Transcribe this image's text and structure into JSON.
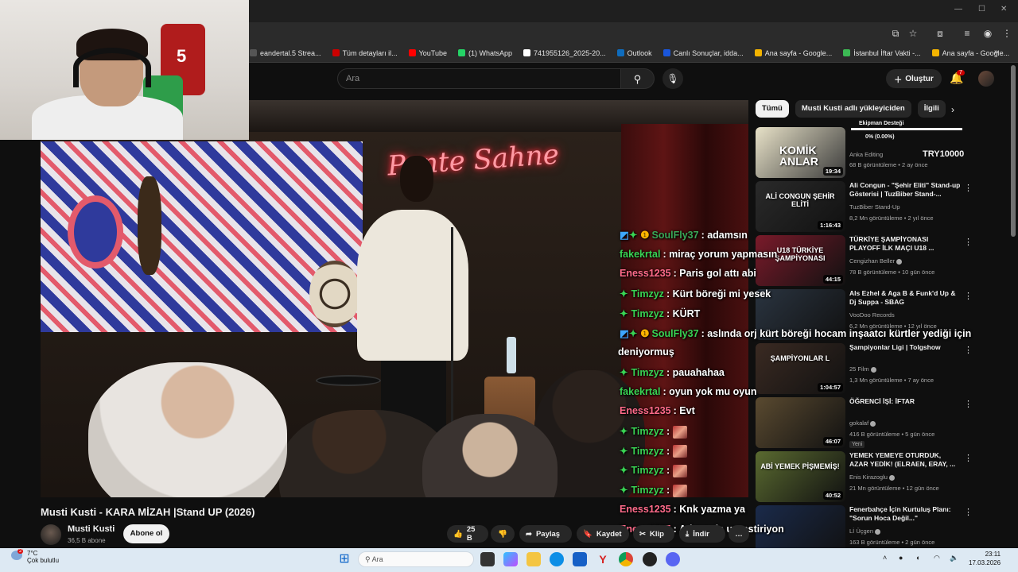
{
  "browser": {
    "bookmarks": [
      {
        "label": "eandertal.5 Strea...",
        "color": "#555555"
      },
      {
        "label": "Tüm detayları il...",
        "color": "#cc0000"
      },
      {
        "label": "YouTube",
        "color": "#ff0000"
      },
      {
        "label": "(1) WhatsApp",
        "color": "#25d366"
      },
      {
        "label": "741955126_2025-20...",
        "color": "#ffffff"
      },
      {
        "label": "Outlook",
        "color": "#0f6cbd"
      },
      {
        "label": "Canlı Sonuçlar, idda...",
        "color": "#1a56db"
      },
      {
        "label": "Ana sayfa - Google...",
        "color": "#f4b400"
      },
      {
        "label": "İstanbul İftar Vakti -...",
        "color": "#3cba54"
      },
      {
        "label": "Ana sayfa - Google...",
        "color": "#f4b400"
      }
    ]
  },
  "header": {
    "search_placeholder": "Ara",
    "create_label": "Oluştur",
    "notif_count": "7"
  },
  "video": {
    "title": "Musti Kusti - KARA MİZAH  |Stand UP (2026)",
    "neon_sign": "Ponte Sahne",
    "jersey_number": "5",
    "channel": "Musti Kusti",
    "subscribers": "36,5 B abone",
    "subscribe_label": "Abone ol",
    "likes": "25 B",
    "share_label": "Paylaş",
    "save_label": "Kaydet",
    "clip_label": "Klip",
    "download_label": "İndir"
  },
  "chat": [
    {
      "user": "SoulFly37",
      "color": "#3aa757",
      "text": "adamsın",
      "badges": true
    },
    {
      "user": "fakekrtal",
      "color": "#39d353",
      "text": "miraç yorum yapmasın"
    },
    {
      "user": "Eness1235",
      "color": "#ff6b8a",
      "text": "Paris gol attı abi"
    },
    {
      "user": "Timzyz",
      "color": "#39d353",
      "text": "Kürt böreği mi yesek",
      "diamond": true
    },
    {
      "user": "Timzyz",
      "color": "#39d353",
      "text": "KÜRT",
      "diamond": true
    },
    {
      "user": "SoulFly37",
      "color": "#39d353",
      "text": "aslında orj kürt böreği hocam inşaatcı kürtler yediği için",
      "badges": true
    },
    {
      "user": "",
      "color": "#ffffff",
      "text": "deniyormuş"
    },
    {
      "user": "Timzyz",
      "color": "#39d353",
      "text": "pauahahaa",
      "diamond": true
    },
    {
      "user": "fakekrtal",
      "color": "#39d353",
      "text": "oyun yok mu oyun"
    },
    {
      "user": "Eness1235",
      "color": "#ff6b8a",
      "text": "Evt"
    },
    {
      "user": "Timzyz",
      "color": "#39d353",
      "text": "",
      "diamond": true,
      "emote": true
    },
    {
      "user": "Timzyz",
      "color": "#39d353",
      "text": "",
      "diamond": true,
      "emote": true
    },
    {
      "user": "Timzyz",
      "color": "#39d353",
      "text": "",
      "diamond": true,
      "emote": true
    },
    {
      "user": "Timzyz",
      "color": "#39d353",
      "text": "",
      "diamond": true,
      "emote": true
    },
    {
      "user": "Eness1235",
      "color": "#ff6b8a",
      "text": "Knk yazma ya"
    },
    {
      "user": "Eness1235",
      "color": "#ff6b8a",
      "text": "Adamı da ugrastiriyon"
    }
  ],
  "sidebar": {
    "chips": [
      "Tümü",
      "Musti Kusti adlı yükleyiciden",
      "İlgili"
    ],
    "ad": {
      "support": "Ekipman Desteği",
      "percent": "0% (0.00%)",
      "thumb_text": "KOMİK ANLAR",
      "duration": "19:34",
      "channel": "Anka Editing",
      "meta": "68 B görüntüleme • 2 ay önce",
      "price": "TRY10000"
    },
    "items": [
      {
        "title": "Ali Congun - \"Şehir Eliti\" Stand-up Gösterisi | TuzBiber Stand-...",
        "channel": "TuzBiber Stand-Up",
        "meta": "8,2 Mn görüntüleme • 2 yıl önce",
        "duration": "1:16:43",
        "thumb_text": "ALİ CONGUN ŞEHİR ELİTİ",
        "thumb_color": "#2a2a2a",
        "verified": false
      },
      {
        "title": "TÜRKİYE ŞAMPİYONASI PLAYOFF İLK MAÇI U18 ...",
        "channel": "Cengizhan Beller",
        "meta": "78 B görüntüleme • 10 gün önce",
        "duration": "44:15",
        "thumb_text": "U18 TÜRKİYE ŞAMPİYONASI",
        "thumb_color": "#7a1a2a",
        "verified": true
      },
      {
        "title": "Als Ezhel & Aga B & Funk'd Up & Dj Suppa - SBAG",
        "channel": "VooDoo Records",
        "meta": "6,2 Mn görüntüleme • 12 yıl önce",
        "duration": "",
        "thumb_text": "",
        "thumb_color": "#2a3440",
        "verified": false
      },
      {
        "title": "Şampiyonlar Ligi | Tolgshow",
        "channel": "25 Film",
        "meta": "1,3 Mn görüntüleme • 7 ay önce",
        "duration": "1:04:57",
        "thumb_text": "ŞAMPİYONLAR L",
        "thumb_color": "#3a2a22",
        "verified": true
      },
      {
        "title": "ÖĞRENCİ İŞİ: İFTAR",
        "channel": "gokalaf",
        "meta": "416 B görüntüleme • 5 gün önce",
        "duration": "46:07",
        "thumb_text": "",
        "thumb_color": "#5a4a30",
        "verified": true,
        "new": "Yeni"
      },
      {
        "title": "YEMEK YEMEYE OTURDUK, AZAR YEDİK! (ELRAEN, ERAY, ...",
        "channel": "Enis Kirazoglu",
        "meta": "21 Mn görüntüleme • 12 gün önce",
        "duration": "40:52",
        "thumb_text": "ABİ YEMEK PİŞMEMİŞ!",
        "thumb_color": "#5a6a30",
        "verified": true
      },
      {
        "title": "Fenerbahçe İçin Kurtuluş Planı: \"Sorun Hoca Değil...\"",
        "channel": "Lİ Üçgen",
        "meta": "163 B görüntüleme • 2 gün önce",
        "duration": "",
        "thumb_text": "",
        "thumb_color": "#1a2a4a",
        "verified": true
      }
    ]
  },
  "taskbar": {
    "temp": "7°C",
    "weather": "Çok bulutlu",
    "weather_badge": "2",
    "search_placeholder": "Ara",
    "time": "23:11",
    "date": "17.03.2026"
  }
}
